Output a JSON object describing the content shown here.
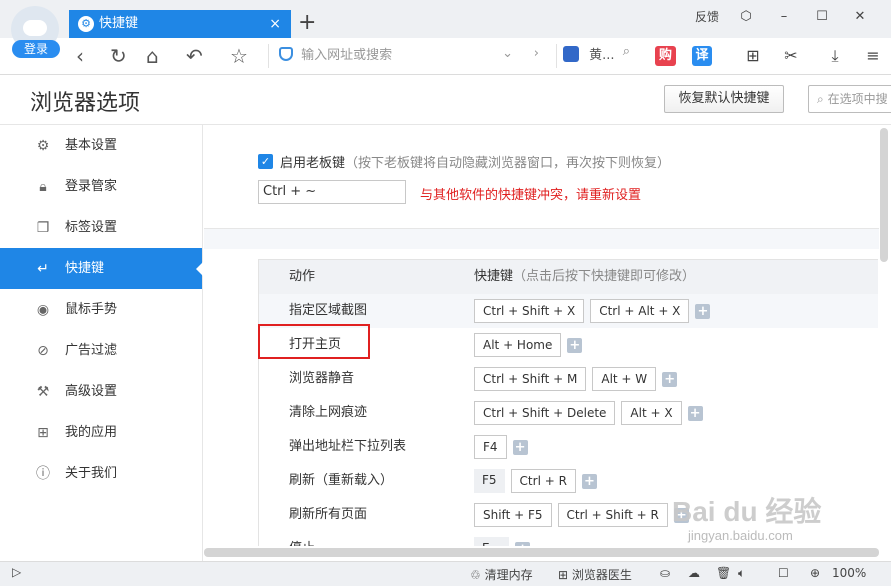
{
  "window": {
    "login_label": "登录",
    "tab_title": "快捷键",
    "tab_close": "×",
    "new_tab": "+",
    "feedback": "反馈",
    "controls": [
      "⬡",
      "–",
      "☐",
      "✕"
    ]
  },
  "address_bar": {
    "url_placeholder": "输入网址或搜索",
    "search_engine_text": "黄..."
  },
  "extensions": {
    "gou": "购",
    "yi": "译"
  },
  "page": {
    "title": "浏览器选项",
    "restore_button": "恢复默认快捷键",
    "search_placeholder": "在选项中搜"
  },
  "sidebar": {
    "items": [
      {
        "label": "基本设置",
        "icon": "gear-icon"
      },
      {
        "label": "登录管家",
        "icon": "lock-icon"
      },
      {
        "label": "标签设置",
        "icon": "tabs-icon"
      },
      {
        "label": "快捷键",
        "icon": "shortcut-icon",
        "active": true
      },
      {
        "label": "鼠标手势",
        "icon": "mouse-icon"
      },
      {
        "label": "广告过滤",
        "icon": "block-icon"
      },
      {
        "label": "高级设置",
        "icon": "wrench-icon"
      },
      {
        "label": "我的应用",
        "icon": "apps-icon"
      },
      {
        "label": "关于我们",
        "icon": "info-icon"
      }
    ]
  },
  "boss_key": {
    "label": "启用老板键",
    "hint": "（按下老板键将自动隐藏浏览器窗口，再次按下则恢复）",
    "value": "Ctrl + ~",
    "conflict": "与其他软件的快捷键冲突，请重新设置"
  },
  "shortcuts": {
    "header_action": "动作",
    "header_key": "快捷键",
    "header_key_hint": "（点击后按下快捷键即可修改）",
    "rows": [
      {
        "action": "指定区域截图",
        "keys": [
          "Ctrl + Shift + X",
          "Ctrl + Alt + X"
        ]
      },
      {
        "action": "打开主页",
        "keys": [
          "Alt + Home"
        ]
      },
      {
        "action": "浏览器静音",
        "keys": [
          "Ctrl + Shift + M",
          "Alt + W"
        ]
      },
      {
        "action": "清除上网痕迹",
        "keys": [
          "Ctrl + Shift + Delete",
          "Alt + X"
        ]
      },
      {
        "action": "弹出地址栏下拉列表",
        "keys": [
          "F4"
        ]
      },
      {
        "action": "刷新（重新载入）",
        "keys": [
          "F5",
          "Ctrl + R"
        ]
      },
      {
        "action": "刷新所有页面",
        "keys": [
          "Shift + F5",
          "Ctrl + Shift + R"
        ]
      },
      {
        "action": "停止",
        "keys": [
          "E..."
        ]
      }
    ]
  },
  "statusbar": {
    "clean_memory": "清理内存",
    "doctor": "浏览器医生",
    "zoom": "100%"
  },
  "watermark": {
    "brand": "Bai du 经验",
    "url": "jingyan.baidu.com"
  }
}
